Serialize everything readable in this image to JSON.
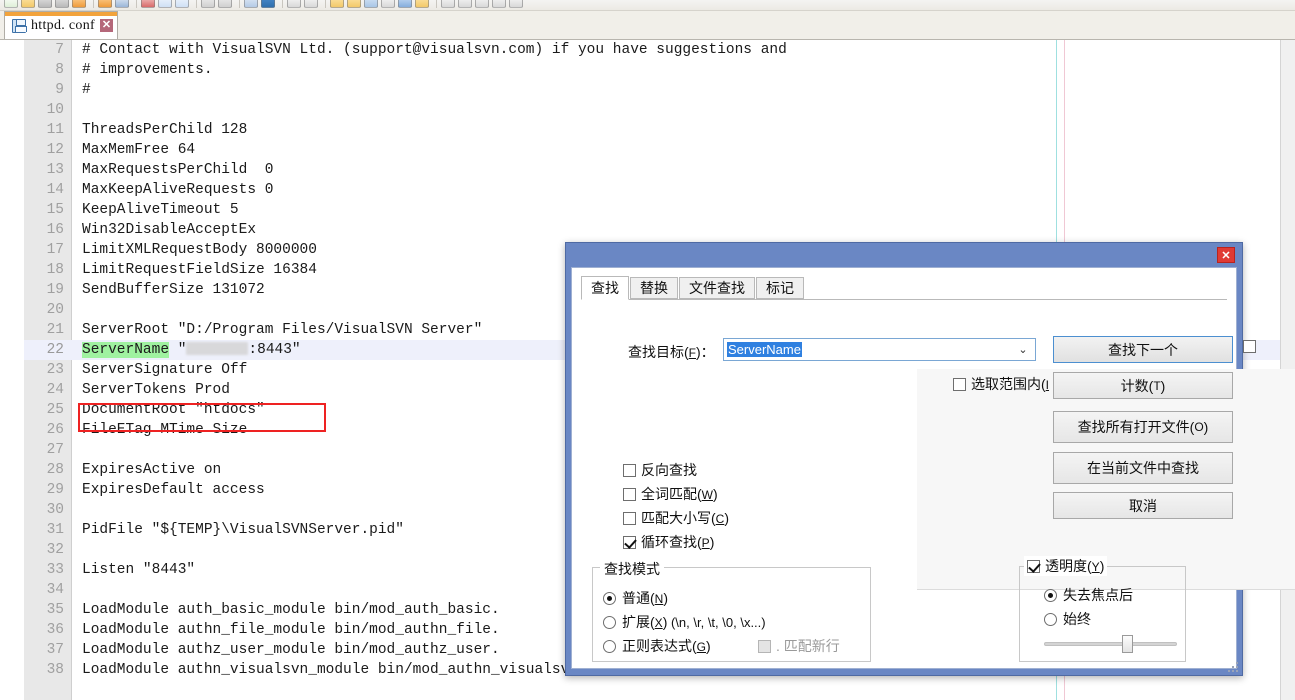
{
  "toolbar": {
    "icon_count": 26
  },
  "tab": {
    "label": "httpd. conf",
    "save_icon": "floppy-disk-icon",
    "close_label": "✕"
  },
  "editor": {
    "first_line_number": 7,
    "current_line": 22,
    "lines": [
      {
        "n": 7,
        "text": "# Contact with VisualSVN Ltd. (support@visualsvn.com) if you have suggestions and"
      },
      {
        "n": 8,
        "text": "# improvements."
      },
      {
        "n": 9,
        "text": "#"
      },
      {
        "n": 10,
        "text": ""
      },
      {
        "n": 11,
        "text": "ThreadsPerChild 128"
      },
      {
        "n": 12,
        "text": "MaxMemFree 64"
      },
      {
        "n": 13,
        "text": "MaxRequestsPerChild  0"
      },
      {
        "n": 14,
        "text": "MaxKeepAliveRequests 0"
      },
      {
        "n": 15,
        "text": "KeepAliveTimeout 5"
      },
      {
        "n": 16,
        "text": "Win32DisableAcceptEx"
      },
      {
        "n": 17,
        "text": "LimitXMLRequestBody 8000000"
      },
      {
        "n": 18,
        "text": "LimitRequestFieldSize 16384"
      },
      {
        "n": 19,
        "text": "SendBufferSize 131072"
      },
      {
        "n": 20,
        "text": ""
      },
      {
        "n": 21,
        "text": "ServerRoot \"D:/Program Files/VisualSVN Server\""
      },
      {
        "n": 22,
        "text": "ServerName \""
      },
      {
        "n": 23,
        "text": "ServerSignature Off"
      },
      {
        "n": 24,
        "text": "ServerTokens Prod"
      },
      {
        "n": 25,
        "text": "DocumentRoot \"htdocs\""
      },
      {
        "n": 26,
        "text": "FileETag MTime Size"
      },
      {
        "n": 27,
        "text": ""
      },
      {
        "n": 28,
        "text": "ExpiresActive on"
      },
      {
        "n": 29,
        "text": "ExpiresDefault access"
      },
      {
        "n": 30,
        "text": ""
      },
      {
        "n": 31,
        "text": "PidFile \"${TEMP}\\VisualSVNServer.pid\""
      },
      {
        "n": 32,
        "text": ""
      },
      {
        "n": 33,
        "text": "Listen \"8443\""
      },
      {
        "n": 34,
        "text": ""
      },
      {
        "n": 35,
        "text": "LoadModule auth_basic_module bin/mod_auth_basic."
      },
      {
        "n": 36,
        "text": "LoadModule authn_file_module bin/mod_authn_file."
      },
      {
        "n": 37,
        "text": "LoadModule authz_user_module bin/mod_authz_user."
      },
      {
        "n": 38,
        "text": "LoadModule authn_visualsvn_module bin/mod_authn_visualsvn.so"
      }
    ],
    "server_name_line": {
      "keyword": "ServerName",
      "quote_open": "\"",
      "host": "",
      "port_tail": ":8443\""
    },
    "annotation": {
      "shape": "red-rectangle",
      "color": "#ee2222"
    }
  },
  "dialog": {
    "close_label": "✕",
    "tabs": [
      {
        "label": "查找",
        "active": true
      },
      {
        "label": "替换",
        "active": false
      },
      {
        "label": "文件查找",
        "active": false
      },
      {
        "label": "标记",
        "active": false
      }
    ],
    "find_label": "查找目标(",
    "find_label_mnemonic": "F",
    "find_label_tail": ")：",
    "find_value": "ServerName",
    "combo_arrow": "⌄",
    "buttons": [
      {
        "key": "find_next",
        "label": "查找下一个"
      },
      {
        "key": "count",
        "label": "计数(",
        "mnemonic": "T",
        "tail": ")"
      },
      {
        "key": "find_all_open",
        "label": "查找所有打开文件(",
        "mnemonic": "O",
        "tail": ")"
      },
      {
        "key": "find_in_current",
        "label": "在当前文件中查找"
      },
      {
        "key": "cancel",
        "label": "取消"
      }
    ],
    "in_selection": {
      "label": "选取范围内(",
      "mnemonic": "I",
      "checked": false
    },
    "options": [
      {
        "label": "反向查找",
        "mnemonic": "",
        "tail": "",
        "checked": false
      },
      {
        "label": "全词匹配(",
        "mnemonic": "W",
        "tail": ")",
        "checked": false
      },
      {
        "label": "匹配大小写(",
        "mnemonic": "C",
        "tail": ")",
        "checked": false
      },
      {
        "label": "循环查找(",
        "mnemonic": "P",
        "tail": ")",
        "checked": true
      }
    ],
    "search_mode": {
      "title": "查找模式",
      "items": [
        {
          "label": "普通(",
          "mnemonic": "N",
          "tail": ")",
          "selected": true,
          "extra": ""
        },
        {
          "label": "扩展(",
          "mnemonic": "X",
          "tail": ")",
          "selected": false,
          "extra": " (\\n, \\r, \\t, \\0, \\x...)"
        },
        {
          "label": "正则表达式(",
          "mnemonic": "G",
          "tail": ")",
          "selected": false,
          "extra": ""
        }
      ],
      "dot_matches_newline": {
        "label": ". 匹配新行",
        "checked": false,
        "disabled": true
      }
    },
    "transparency": {
      "label": "透明度(",
      "mnemonic": "Y",
      "tail": ")",
      "checked": true,
      "options": [
        {
          "label": "失去焦点后",
          "selected": true
        },
        {
          "label": "始终",
          "selected": false
        }
      ],
      "slider_percent": 64
    }
  },
  "colors": {
    "accent": "#6a87c4",
    "close_red": "#e03a34",
    "annotation_red": "#ee2222",
    "match_green": "#9ff2a0",
    "selection_blue": "#2f80e0",
    "tab_active_orange": "#f2a33c"
  }
}
